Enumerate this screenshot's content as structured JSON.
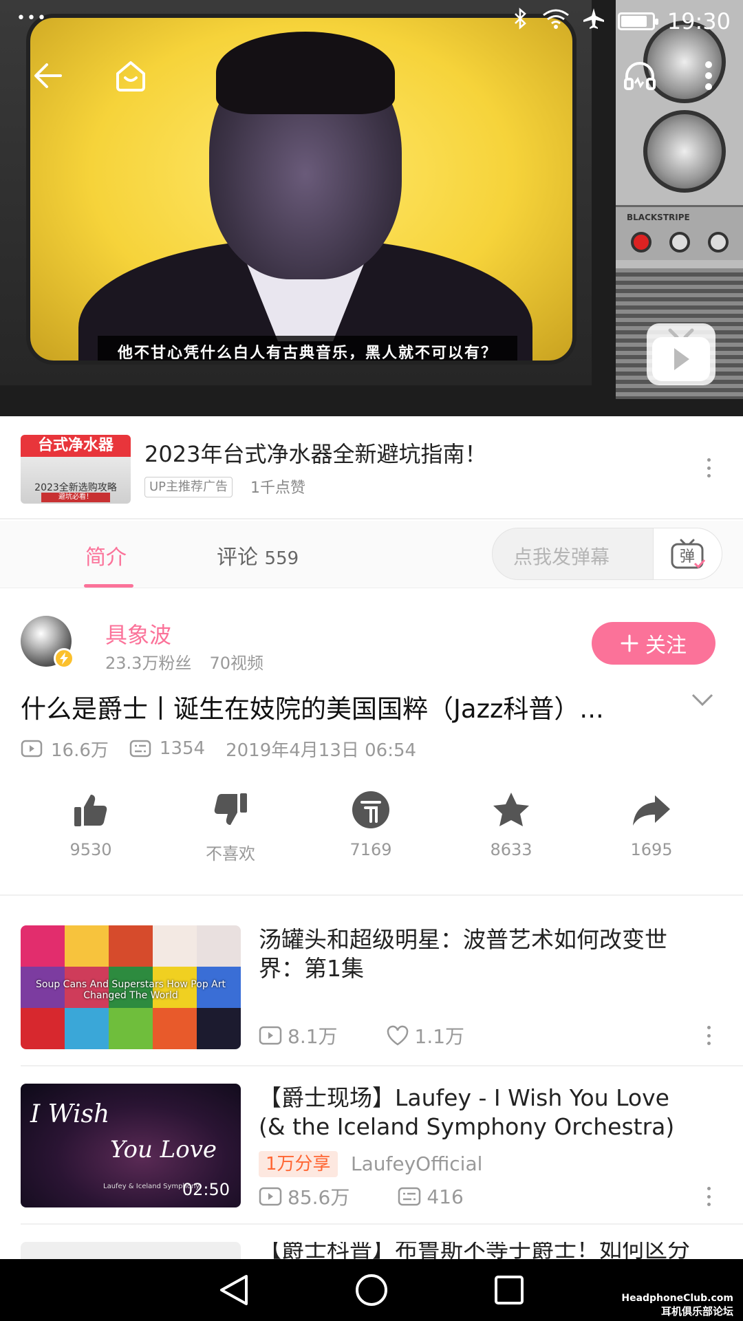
{
  "status_bar": {
    "time": "19:30",
    "battery_level": 0.8
  },
  "player": {
    "subtitle": "他不甘心凭什么白人有古典音乐，黑人就不可以有？",
    "tv_brand": "BLACKSTRIPE"
  },
  "ad": {
    "thumb_title": "台式净水器",
    "thumb_subtitle": "2023全新选购攻略",
    "thumb_banner": "避坑必看！",
    "title": "2023年台式净水器全新避坑指南！",
    "tag": "UP主推荐广告",
    "likes": "1千点赞"
  },
  "tabs": {
    "intro": "简介",
    "comments": "评论",
    "comments_count": "559",
    "danmaku_placeholder": "点我发弹幕",
    "danmaku_button": "弹"
  },
  "uploader": {
    "name": "具象波",
    "fans": "23.3万粉丝",
    "videos": "70视频",
    "follow_label": "关注"
  },
  "video": {
    "title": "什么是爵士丨诞生在妓院的美国国粹（Jazz科普）...",
    "views": "16.6万",
    "danmaku_count": "1354",
    "date": "2019年4月13日 06:54"
  },
  "actions": {
    "like": "9530",
    "dislike": "不喜欢",
    "coin": "7169",
    "favorite": "8633",
    "share": "1695"
  },
  "recommendations": [
    {
      "title": "汤罐头和超级明星：波普艺术如何改变世界：第1集",
      "thumb_text": "Soup Cans And Superstars How Pop Art Changed The World",
      "views": "8.1万",
      "likes": "1.1万"
    },
    {
      "title": "【爵士现场】Laufey - I Wish You Love (& the Iceland Symphony Orchestra)",
      "thumb_line1": "I Wish",
      "thumb_line2": "You Love",
      "thumb_caption": "Laufey & Iceland Symphony",
      "duration": "02:50",
      "tag": "1万分享",
      "owner": "LaufeyOfficial",
      "views": "85.6万",
      "danmaku": "416"
    },
    {
      "title": "【爵士科普】布鲁斯不等于爵士！如何区分"
    }
  ],
  "watermark": {
    "line1": "HeadphoneClub.com",
    "line2": "耳机俱乐部论坛"
  },
  "colors": {
    "accent": "#fb7299",
    "muted": "#999999",
    "ad_red": "#e8353b"
  }
}
